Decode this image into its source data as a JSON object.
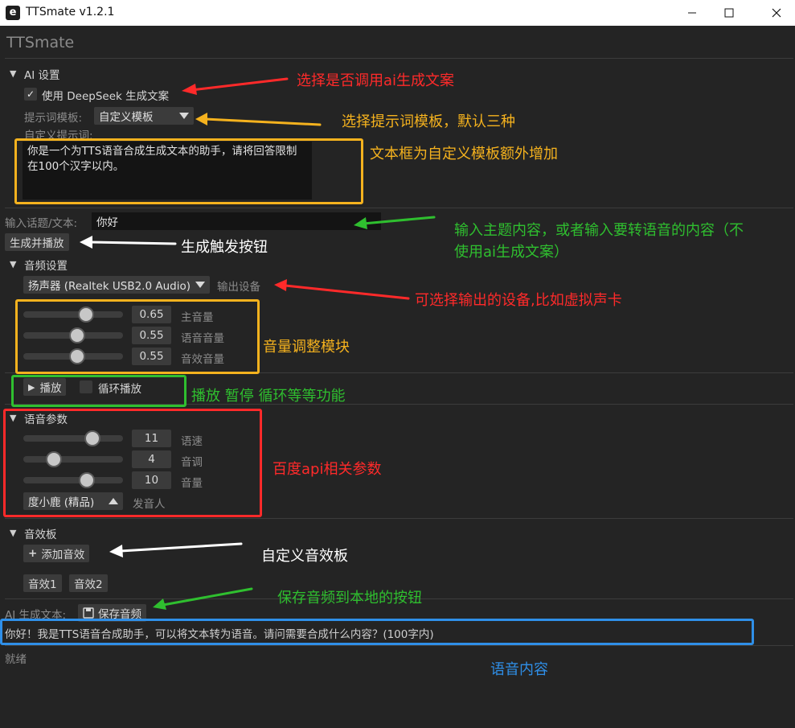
{
  "window": {
    "title": "TTSmate v1.2.1",
    "icon_letter": "e"
  },
  "app_title": "TTSmate",
  "ai_settings": {
    "header": "AI 设置",
    "use_deepseek_label": "使用 DeepSeek 生成文案",
    "use_deepseek_checked": true,
    "check_glyph": "✓",
    "prompt_template_label": "提示词模板:",
    "prompt_template_value": "自定义模板",
    "custom_prompt_label": "自定义提示词:",
    "custom_prompt_text": "你是一个为TTS语音合成生成文本的助手，请将回答限制在100个汉字以内。"
  },
  "input": {
    "label": "输入话题/文本:",
    "value": "你好"
  },
  "generate_button": "生成并播放",
  "audio_settings": {
    "header": "音频设置",
    "device_value": "扬声器 (Realtek USB2.0 Audio)",
    "device_label": "输出设备",
    "sliders": [
      {
        "value": "0.65",
        "label": "主音量",
        "level": 0.65
      },
      {
        "value": "0.55",
        "label": "语音音量",
        "level": 0.55
      },
      {
        "value": "0.55",
        "label": "音效音量",
        "level": 0.55
      }
    ]
  },
  "playback": {
    "play_label": "播放",
    "play_glyph": "▶",
    "loop_label": "循环播放",
    "loop_checked": false
  },
  "voice_params": {
    "header": "语音参数",
    "sliders": [
      {
        "value": "11",
        "label": "语速",
        "level": 0.733
      },
      {
        "value": "4",
        "label": "音调",
        "level": 0.267
      },
      {
        "value": "10",
        "label": "音量",
        "level": 0.667
      }
    ],
    "speaker_value": "度小鹿 (精品)",
    "speaker_label": "发音人"
  },
  "soundboard": {
    "header": "音效板",
    "add_label": "添加音效",
    "add_glyph": "+",
    "sounds": [
      "音效1",
      "音效2"
    ]
  },
  "ai_output": {
    "label": "AI 生成文本:",
    "save_label": "保存音频",
    "text": "你好！我是TTS语音合成助手，可以将文本转为语音。请问需要合成什么内容？(100字内)"
  },
  "status": "就绪",
  "annotations": {
    "a1": "选择是否调用ai生成文案",
    "a2": "选择提示词模板，默认三种",
    "a3": "文本框为自定义模板额外增加",
    "a4_line1": "输入主题内容，或者输入要转语音的内容（不",
    "a4_line2": "使用ai生成文案）",
    "a5": "生成触发按钮",
    "a6": "可选择输出的设备,比如虚拟声卡",
    "a7": "音量调整模块",
    "a8": "播放 暂停 循环等等功能",
    "a9": "百度api相关参数",
    "a10": "自定义音效板",
    "a11": "保存音频到本地的按钮",
    "a12": "语音内容"
  },
  "colors": {
    "red": "#ff2a2a",
    "orange": "#f5b21e",
    "green": "#2fbf2f",
    "white": "#ffffff",
    "blue": "#2f8fe8",
    "background": "#242424"
  }
}
